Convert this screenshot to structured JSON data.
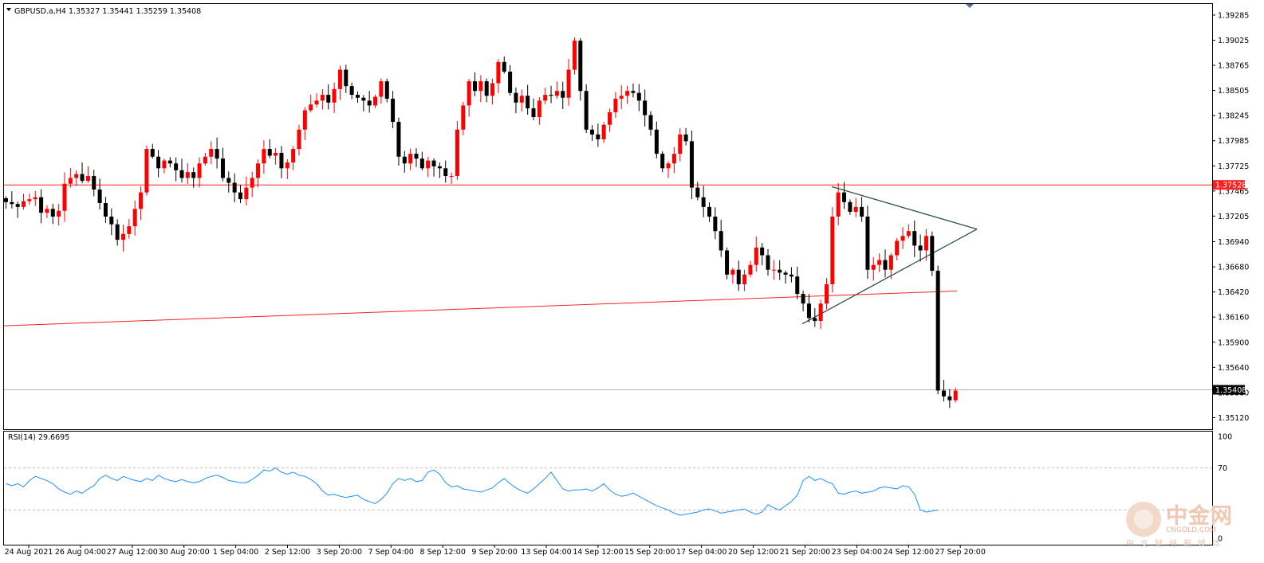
{
  "header": {
    "symbol_line": "GBPUSD.a,H4  1.35327 1.35441 1.35259 1.35408",
    "rsi_line": "RSI(14) 29.6695"
  },
  "colors": {
    "bull": "#ff0000",
    "bear": "#000000",
    "hline": "#ff2020",
    "trendline": "#ff2020",
    "triangle": "#2f4f4f",
    "rsi": "#1e90ff",
    "price_line": "#a9b6c8",
    "frame": "#000000"
  },
  "chart_data": {
    "type": "candlestick",
    "symbol": "GBPUSD.a",
    "timeframe": "H4",
    "ylim": [
      1.35,
      1.394
    ],
    "yticks": [
      "1.39285",
      "1.39025",
      "1.38765",
      "1.38505",
      "1.38245",
      "1.37985",
      "1.37725",
      "1.37465",
      "1.37205",
      "1.36940",
      "1.36680",
      "1.36420",
      "1.36160",
      "1.35900",
      "1.35640",
      "1.35380",
      "1.35120"
    ],
    "xticks": [
      "24 Aug 2021",
      "26 Aug 04:00",
      "27 Aug 12:00",
      "30 Aug 20:00",
      "1 Sep 04:00",
      "2 Sep 12:00",
      "3 Sep 20:00",
      "7 Sep 04:00",
      "8 Sep 12:00",
      "9 Sep 20:00",
      "13 Sep 04:00",
      "14 Sep 12:00",
      "15 Sep 20:00",
      "17 Sep 04:00",
      "20 Sep 12:00",
      "21 Sep 20:00",
      "23 Sep 04:00",
      "24 Sep 12:00",
      "27 Sep 20:00"
    ],
    "closes": [
      1.3735,
      1.3733,
      1.373,
      1.3736,
      1.3738,
      1.374,
      1.3724,
      1.3728,
      1.372,
      1.3726,
      1.3754,
      1.376,
      1.3764,
      1.3757,
      1.3762,
      1.3748,
      1.3734,
      1.372,
      1.3712,
      1.3696,
      1.3702,
      1.371,
      1.3728,
      1.3745,
      1.379,
      1.3782,
      1.377,
      1.3778,
      1.3775,
      1.3768,
      1.376,
      1.3766,
      1.376,
      1.3775,
      1.3782,
      1.379,
      1.378,
      1.376,
      1.3755,
      1.3745,
      1.3738,
      1.375,
      1.376,
      1.3775,
      1.379,
      1.3783,
      1.3786,
      1.377,
      1.3776,
      1.379,
      1.381,
      1.383,
      1.3836,
      1.384,
      1.3846,
      1.3838,
      1.3852,
      1.3872,
      1.3855,
      1.3846,
      1.3843,
      1.384,
      1.3835,
      1.3844,
      1.386,
      1.3842,
      1.3818,
      1.3782,
      1.3775,
      1.3785,
      1.378,
      1.377,
      1.3778,
      1.3772,
      1.377,
      1.3762,
      1.3762,
      1.381,
      1.3835,
      1.386,
      1.385,
      1.386,
      1.3845,
      1.3858,
      1.388,
      1.387,
      1.3848,
      1.3838,
      1.3845,
      1.3832,
      1.3823,
      1.384,
      1.3846,
      1.3845,
      1.385,
      1.3843,
      1.3872,
      1.3902,
      1.385,
      1.381,
      1.3805,
      1.38,
      1.3815,
      1.3828,
      1.3842,
      1.3845,
      1.385,
      1.3848,
      1.384,
      1.3825,
      1.381,
      1.3785,
      1.377,
      1.3775,
      1.3785,
      1.3805,
      1.3798,
      1.375,
      1.374,
      1.373,
      1.372,
      1.3705,
      1.3685,
      1.366,
      1.3665,
      1.365,
      1.366,
      1.367,
      1.3688,
      1.368,
      1.3665,
      1.3665,
      1.3662,
      1.366,
      1.3658,
      1.364,
      1.363,
      1.3615,
      1.3612,
      1.363,
      1.365,
      1.372,
      1.3745,
      1.3735,
      1.3725,
      1.373,
      1.372,
      1.3665,
      1.367,
      1.3675,
      1.3665,
      1.368,
      1.3695,
      1.37,
      1.3705,
      1.369,
      1.3685,
      1.37,
      1.3664,
      1.354,
      1.3534,
      1.353,
      1.354
    ]
  },
  "rsi_data": {
    "ylim": [
      0,
      100
    ],
    "levels": [
      70,
      30
    ],
    "ticks": [
      "100",
      "70",
      "0"
    ],
    "values": [
      55,
      53,
      55,
      52,
      58,
      62,
      60,
      58,
      55,
      50,
      47,
      45,
      48,
      46,
      50,
      53,
      60,
      63,
      60,
      58,
      62,
      60,
      58,
      57,
      60,
      58,
      63,
      60,
      58,
      57,
      59,
      57,
      56,
      57,
      60,
      62,
      63,
      61,
      58,
      57,
      56,
      56,
      59,
      63,
      68,
      67,
      70,
      66,
      64,
      66,
      63,
      62,
      59,
      55,
      48,
      44,
      45,
      43,
      42,
      43,
      44,
      40,
      38,
      36,
      40,
      46,
      55,
      60,
      58,
      60,
      57,
      58,
      66,
      68,
      64,
      56,
      52,
      53,
      50,
      49,
      48,
      47,
      49,
      51,
      56,
      60,
      55,
      51,
      48,
      46,
      50,
      55,
      60,
      66,
      58,
      50,
      48,
      49,
      49,
      50,
      48,
      51,
      55,
      49,
      45,
      43,
      44,
      46,
      43,
      40,
      37,
      34,
      32,
      30,
      27,
      25,
      26,
      27,
      28,
      30,
      31,
      29,
      27,
      28,
      29,
      30,
      31,
      28,
      26,
      28,
      35,
      32,
      30,
      34,
      38,
      44,
      58,
      62,
      58,
      60,
      57,
      55,
      46,
      45,
      47,
      48,
      46,
      47,
      48,
      51,
      52,
      51,
      50,
      53,
      52,
      45,
      30,
      28,
      29,
      30
    ]
  }
}
